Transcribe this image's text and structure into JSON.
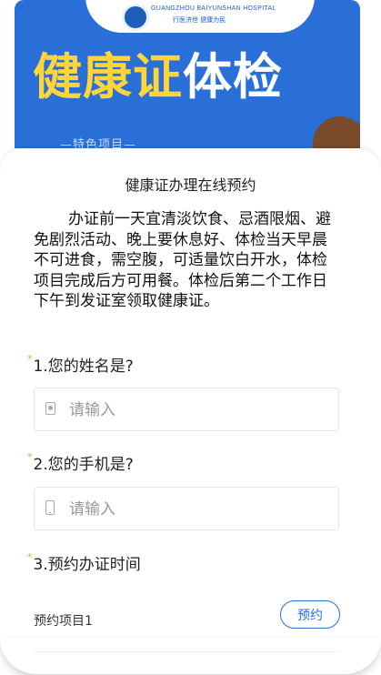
{
  "banner": {
    "logo_en": "GUANGZHOU BAIYUNSHAN HOSPITAL",
    "logo_slogan": "行医济世  健康为民",
    "headline_part1": "健康证",
    "headline_part2": "体检",
    "tag": "—特色项目—"
  },
  "form": {
    "title": "健康证办理在线预约",
    "intro": "办证前一天宜清淡饮食、忌酒限烟、避免剧烈活动、晚上要休息好、体检当天早晨不可进食，需空腹，可适量饮白开水，体检项目完成后方可用餐。体检后第二个工作日下午到发证室领取健康证。",
    "questions": [
      {
        "star": "*",
        "label": "1.您的姓名是?",
        "placeholder": "请输入",
        "icon": "user-icon"
      },
      {
        "star": "*",
        "label": "2.您的手机是?",
        "placeholder": "请输入",
        "icon": "phone-icon"
      },
      {
        "star": "*",
        "label": "3.预约办证时间"
      }
    ],
    "slot": {
      "label": "预约项目1",
      "button": "预约"
    }
  },
  "colors": {
    "accent": "#2a6fd8",
    "required_star": "#f0a43a",
    "headline_yellow": "#ffd53a"
  }
}
